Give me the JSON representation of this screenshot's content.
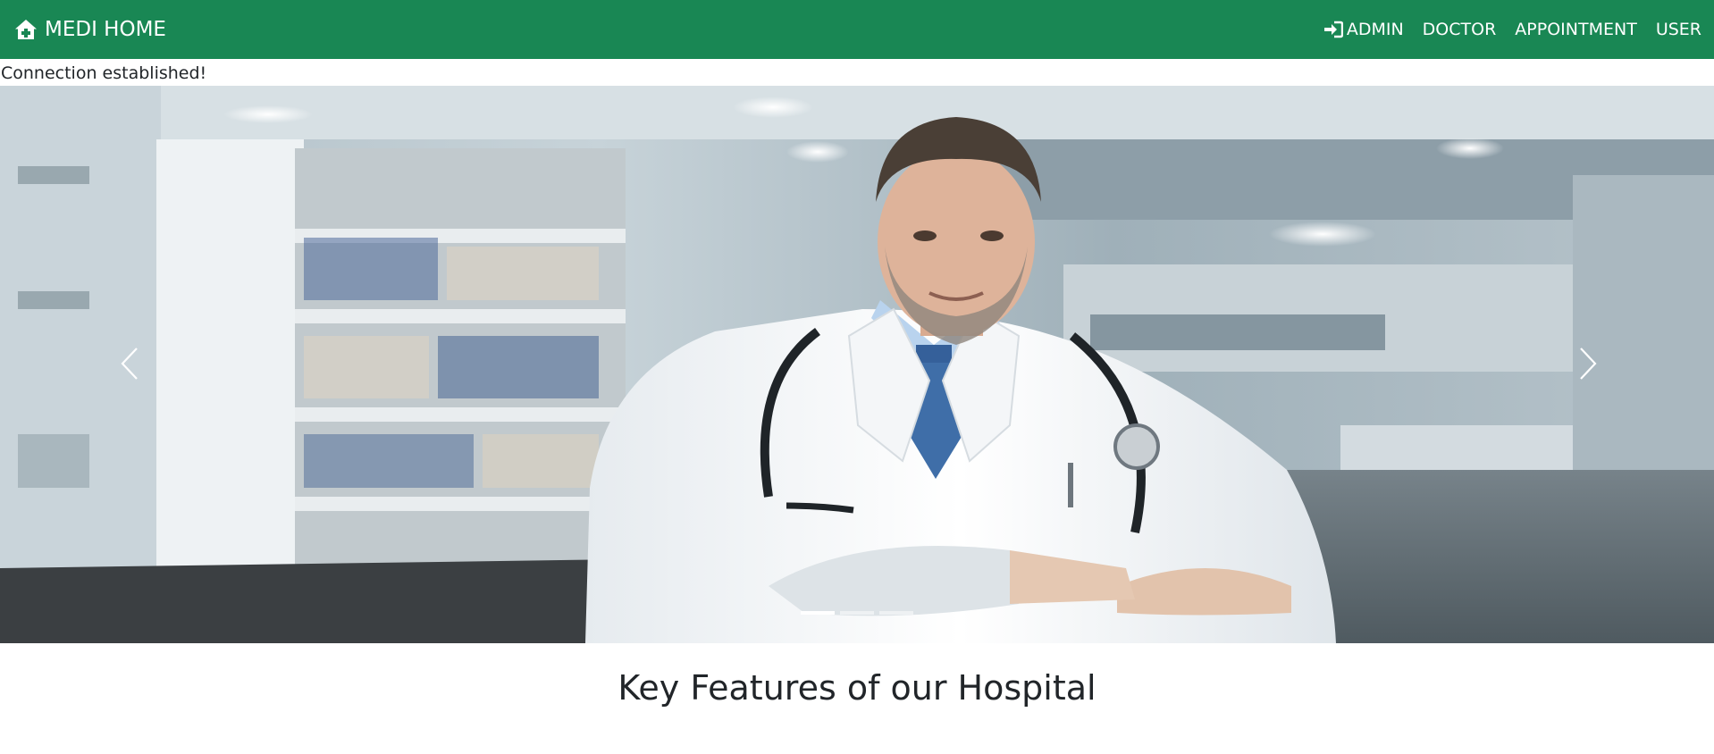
{
  "navbar": {
    "brand_label": "MEDI HOME",
    "brand_icon": "house-medical-icon",
    "links": [
      {
        "label": "ADMIN",
        "icon": "sign-in-icon"
      },
      {
        "label": "DOCTOR"
      },
      {
        "label": "APPOINTMENT"
      },
      {
        "label": "USER"
      }
    ],
    "background_color": "#198754"
  },
  "status": {
    "message": "Connection established!"
  },
  "carousel": {
    "slide_count": 3,
    "active_slide": 1,
    "prev_icon": "chevron-left-icon",
    "next_icon": "chevron-right-icon"
  },
  "features": {
    "heading": "Key Features of our Hospital"
  }
}
